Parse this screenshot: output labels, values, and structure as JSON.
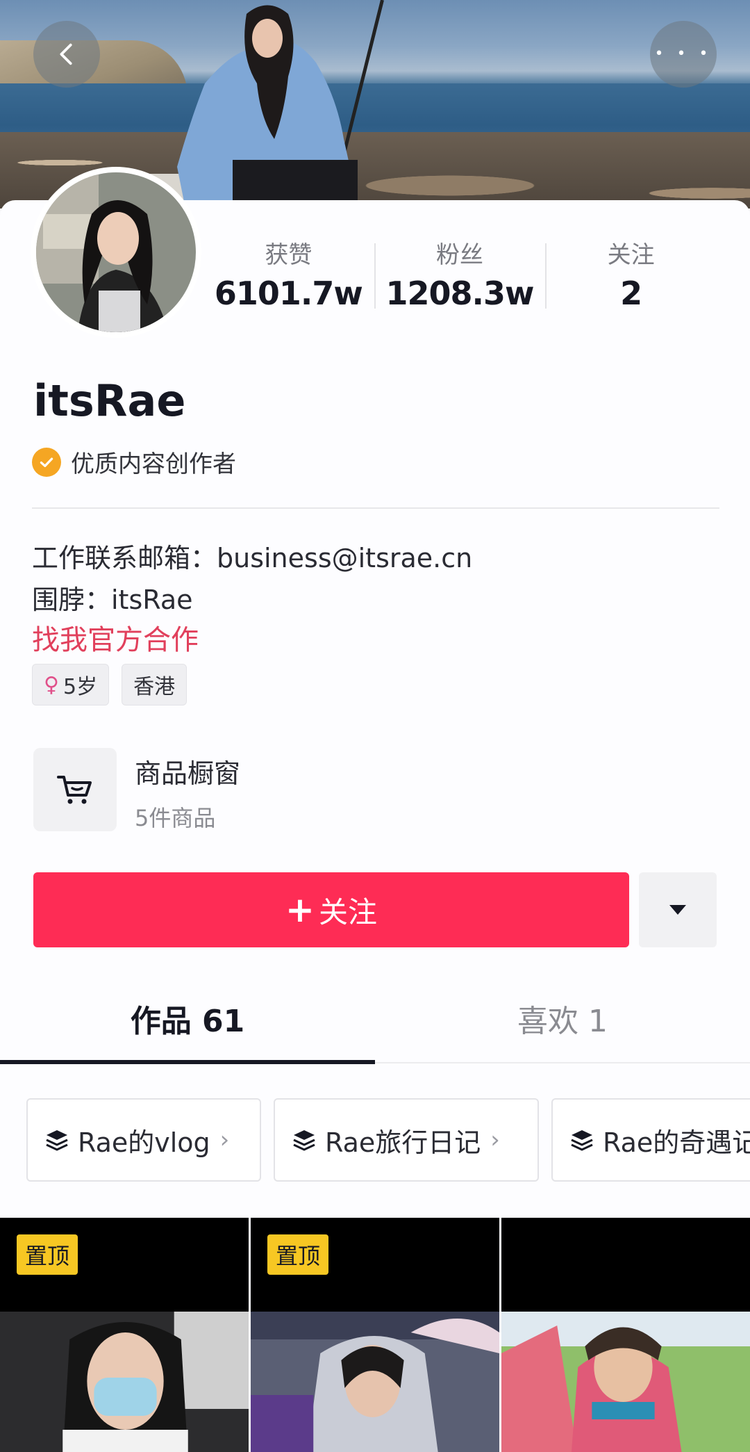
{
  "profile": {
    "name": "itsRae",
    "badge": "优质内容创作者",
    "stats": [
      {
        "label": "获赞",
        "value": "6101.7w"
      },
      {
        "label": "粉丝",
        "value": "1208.3w"
      },
      {
        "label": "关注",
        "value": "2"
      }
    ],
    "bio": {
      "email_line": "工作联系邮箱：business@itsrae.cn",
      "weibo_line": "围脖：itsRae",
      "cooperation_link": "找我官方合作"
    },
    "tags": {
      "age": "5岁",
      "location": "香港"
    }
  },
  "shop": {
    "title": "商品橱窗",
    "subtitle": "5件商品"
  },
  "actions": {
    "follow_label": "关注",
    "follow_symbol": "+"
  },
  "tabs": [
    {
      "label": "作品 61",
      "active": true
    },
    {
      "label": "喜欢 1",
      "active": false
    }
  ],
  "collections": [
    {
      "label": "Rae的vlog"
    },
    {
      "label": "Rae旅行日记"
    },
    {
      "label": "Rae的奇遇记"
    }
  ],
  "videos": [
    {
      "pinned_label": "置顶"
    },
    {
      "pinned_label": "置顶"
    },
    {
      "pinned_label": ""
    }
  ],
  "colors": {
    "accent": "#fe2c55",
    "link": "#e1405c",
    "pin": "#f7c723",
    "badge": "#f5a623"
  }
}
